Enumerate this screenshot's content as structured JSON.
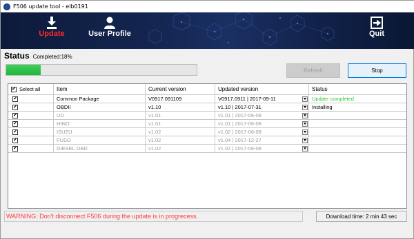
{
  "window": {
    "title": "F506 update tool - elb0191"
  },
  "nav": {
    "update_label": "Update",
    "profile_label": "User Profile",
    "quit_label": "Quit"
  },
  "status": {
    "title": "Status",
    "completed_text": "Completed:18%",
    "progress_fraction": 0.18
  },
  "buttons": {
    "refresh": "Refresh",
    "stop": "Stop"
  },
  "table": {
    "headers": {
      "select_all": "Select all",
      "item": "Item",
      "current_version": "Current version",
      "updated_version": "Updated version",
      "status": "Status"
    },
    "rows": [
      {
        "checked": true,
        "item": "Common Package",
        "current": "V0917.091109",
        "updated": "V0917.0911 | 2017-09-11",
        "status": "Update completed",
        "enabled": true
      },
      {
        "checked": true,
        "item": "OBDII",
        "current": "v1.10",
        "updated": "v1.10 | 2017-07-31",
        "status": "Installing",
        "enabled": true
      },
      {
        "checked": true,
        "item": "UD",
        "current": "v1.01",
        "updated": "v1.01 | 2017-06-08",
        "status": "",
        "enabled": false
      },
      {
        "checked": true,
        "item": "HINO",
        "current": "v1.01",
        "updated": "v1.01 | 2017-06-08",
        "status": "",
        "enabled": false
      },
      {
        "checked": true,
        "item": "ISUZU",
        "current": "v1.02",
        "updated": "v1.02 | 2017-06-08",
        "status": "",
        "enabled": false
      },
      {
        "checked": true,
        "item": "FUSO",
        "current": "v1.02",
        "updated": "v1.04 | 2017-12-27",
        "status": "",
        "enabled": false
      },
      {
        "checked": true,
        "item": "DIESEL OBD",
        "current": "v1.02",
        "updated": "v1.02 | 2017-06-08",
        "status": "",
        "enabled": false
      }
    ]
  },
  "footer": {
    "warning": "WARNING: Don't disconnect F506 during the update is in progrecess.",
    "download_time": "Download time: 2 min 43 sec"
  },
  "colors": {
    "active_nav": "#ff2b2b",
    "progress": "#2ac247",
    "status_done": "#2ec42e",
    "warning": "#ff3a3a"
  }
}
